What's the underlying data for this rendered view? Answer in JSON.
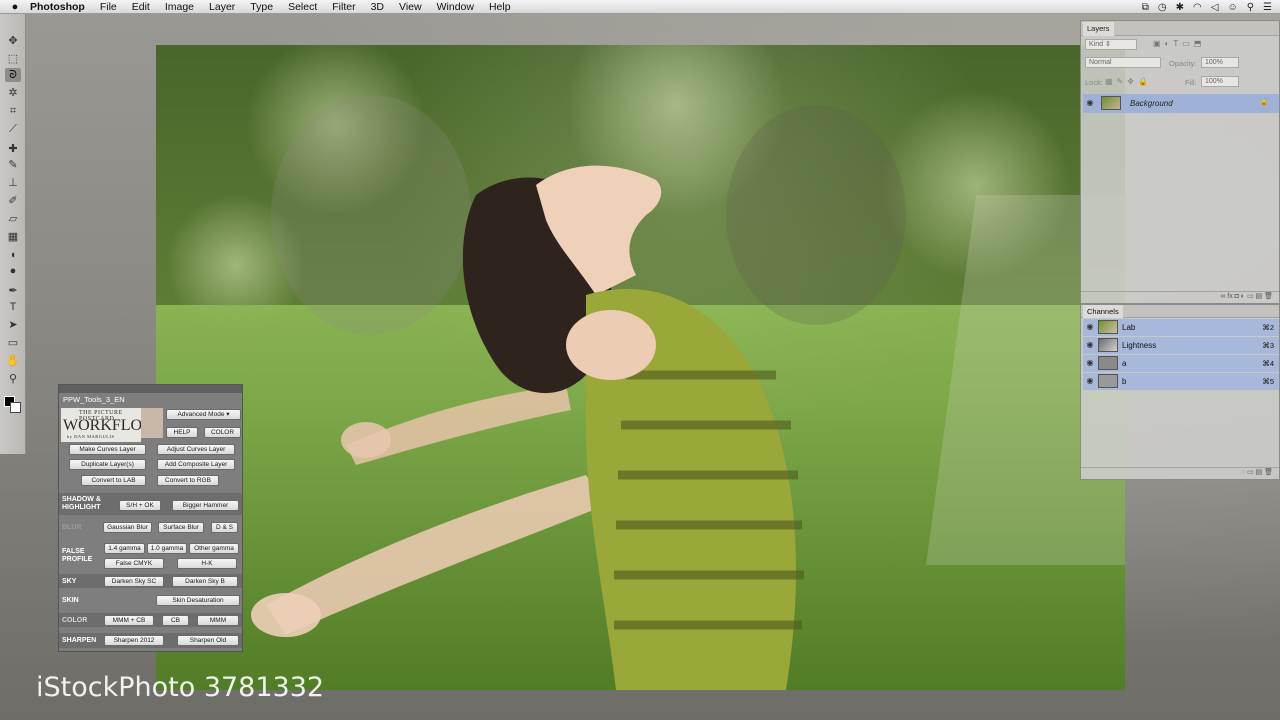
{
  "menubar": {
    "apple": "",
    "app_name": "Photoshop",
    "items": [
      "File",
      "Edit",
      "Image",
      "Layer",
      "Type",
      "Select",
      "Filter",
      "3D",
      "View",
      "Window",
      "Help"
    ]
  },
  "tools": {
    "icons": [
      "move-icon",
      "marquee-icon",
      "lasso-icon",
      "magic-wand-icon",
      "crop-icon",
      "eyedropper-icon",
      "healing-brush-icon",
      "brush-icon",
      "clone-stamp-icon",
      "history-brush-icon",
      "eraser-icon",
      "gradient-icon",
      "blur-icon",
      "dodge-icon",
      "pen-icon",
      "type-icon",
      "path-selection-icon",
      "rectangle-icon",
      "hand-icon",
      "zoom-icon"
    ],
    "glyphs": [
      "✥",
      "⬚",
      "ᘐ",
      "✲",
      "⌗",
      "⟋",
      "✚",
      "✎",
      "⊥",
      "✐",
      "▱",
      "▦",
      "◖",
      "●",
      "✒",
      "T",
      "➤",
      "▭",
      "✋",
      "⚲"
    ]
  },
  "ppw_panel": {
    "title": "PPW_Tools_3_EN",
    "logo": {
      "line1": "THE PICTURE POSTCARD",
      "line2": "WORKFLOW",
      "line3": "by DAN MARGULIS"
    },
    "mode": "Advanced Mode",
    "help": "HELP",
    "color": "COLOR",
    "make_curves": "Make Curves Layer",
    "adjust_curves": "Adjust Curves Layer",
    "duplicate_layers": "Duplicate Layer(s)",
    "add_composite": "Add Composite Layer",
    "convert_lab": "Convert to LAB",
    "convert_rgb": "Convert to RGB",
    "shadow_label": "SHADOW & HIGHLIGHT",
    "sh_ok": "S/H + OK",
    "bigger_hammer": "Bigger Hammer",
    "blur_label": "BLUR",
    "gaussian": "Gaussian Blur",
    "surface": "Surface Blur",
    "ds": "D & S",
    "false_label": "FALSE PROFILE",
    "gamma14": "1.4 gamma",
    "gamma10": "1.0 gamma",
    "other_gamma": "Other gamma",
    "false_cmyk": "False CMYK",
    "hk": "H-K",
    "sky_label": "SKY",
    "darken_sc": "Darken Sky SC",
    "darken_b": "Darken Sky B",
    "skin_label": "SKIN",
    "skin_desat": "Skin Desaturation",
    "color_label": "COLOR",
    "mmm_cb": "MMM + CB",
    "cb": "CB",
    "mmm": "MMM",
    "sharpen_label": "SHARPEN",
    "sharpen2012": "Sharpen 2012",
    "sharpen_old": "Sharpen Old"
  },
  "layers_panel": {
    "tab": "Layers",
    "kind": "Kind",
    "blend": "Normal",
    "opacity_label": "Opacity:",
    "opacity_value": "100%",
    "lock_label": "Lock:",
    "fill_label": "Fill:",
    "fill_value": "100%",
    "layer_name": "Background"
  },
  "channels_panel": {
    "tab": "Channels",
    "rows": [
      {
        "name": "Lab",
        "key": "⌘2"
      },
      {
        "name": "Lightness",
        "key": "⌘3"
      },
      {
        "name": "a",
        "key": "⌘4"
      },
      {
        "name": "b",
        "key": "⌘5"
      }
    ]
  },
  "watermark": "iStockPhoto 3781332",
  "colors": {
    "selection_blue": "#9fb1d6",
    "panel_gray": "#cecdca",
    "ppw_gray": "#7e7e7e"
  }
}
